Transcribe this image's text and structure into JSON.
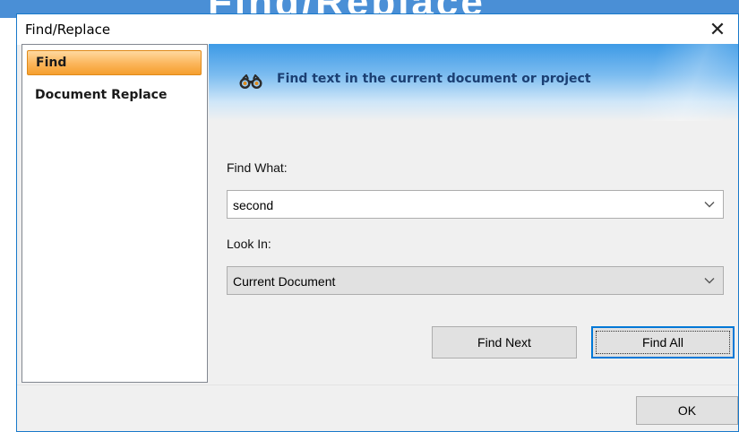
{
  "background": {
    "banner_text": "Find/Replace",
    "color": "#4a8fd6"
  },
  "dialog": {
    "title": "Find/Replace",
    "close_glyph": "✕",
    "border_color": "#1979ca"
  },
  "nav": {
    "items": [
      {
        "label": "Find",
        "active": true
      },
      {
        "label": "Document Replace",
        "active": false
      }
    ],
    "active_color": "#fbb55a"
  },
  "header": {
    "icon": "binoculars-icon",
    "text": "Find text in the current document or project"
  },
  "find_what": {
    "label": "Find What:",
    "value": "second"
  },
  "look_in": {
    "label": "Look In:",
    "value": "Current Document"
  },
  "buttons": {
    "find_next": "Find Next",
    "find_all": "Find All",
    "ok": "OK"
  }
}
